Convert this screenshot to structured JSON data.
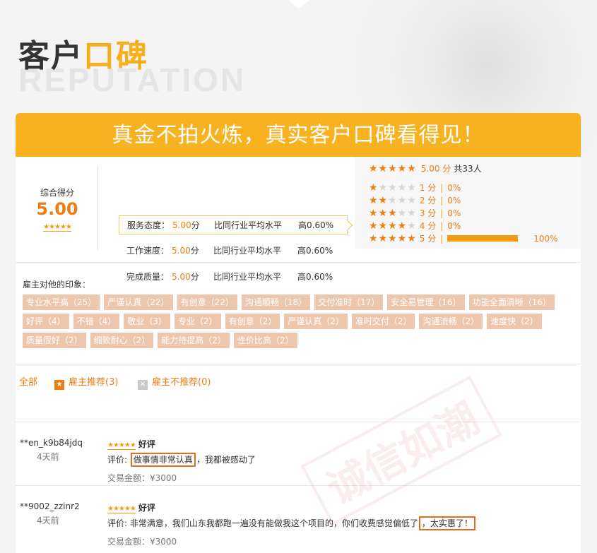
{
  "header": {
    "title_part1": "客户",
    "title_part2": "口碑",
    "watermark": "REPUTATION"
  },
  "banner": {
    "text": "真金不拍火炼，真实客户口碑看得见！"
  },
  "overall": {
    "label": "综合得分",
    "value": "5.00",
    "stars": "★★★★★"
  },
  "metrics": [
    {
      "name": "服务态度：",
      "score": "5.00",
      "unit": "分",
      "compare": "比同行业平均水平",
      "high": "高0.60%"
    },
    {
      "name": "工作速度：",
      "score": "5.00",
      "unit": "分",
      "compare": "比同行业平均水平",
      "high": "高0.60%"
    },
    {
      "name": "完成质量：",
      "score": "5.00",
      "unit": "分",
      "compare": "比同行业平均水平",
      "high": "高0.60%"
    }
  ],
  "distribution": {
    "stars": "★★★★★",
    "avg": "5.00 分",
    "count": "共33人",
    "rows": [
      {
        "on": "★",
        "off": "★★★★",
        "level": "1 分",
        "percent": "0%",
        "fill": 0
      },
      {
        "on": "★★",
        "off": "★★★",
        "level": "2 分",
        "percent": "0%",
        "fill": 0
      },
      {
        "on": "★★★",
        "off": "★★",
        "level": "3 分",
        "percent": "0%",
        "fill": 0
      },
      {
        "on": "★★★★",
        "off": "★",
        "level": "4 分",
        "percent": "0%",
        "fill": 0
      },
      {
        "on": "★★★★★",
        "off": "",
        "level": "5 分",
        "percent": "100%",
        "fill": 100
      }
    ],
    "sep": "|"
  },
  "impressions": {
    "title": "雇主对他的印象：",
    "lines": [
      [
        "专业水平高（25）",
        "严谨认真（22）",
        "有创意（22）",
        "沟通顺畅（18）",
        "交付准时（17）",
        "安全易管理（16）",
        "功能全面清晰（16）"
      ],
      [
        "好评（4）",
        "不错（4）",
        "敬业（3）",
        "专业（2）",
        "有创意（2）",
        "严谨认真（2）",
        "准时交付（2）",
        "沟通流畅（2）",
        "速度快（2）"
      ],
      [
        "质量很好（2）",
        "细致耐心（2）",
        "能力待提高（2）",
        "性价比高（2）"
      ]
    ]
  },
  "filters": {
    "all": "全部",
    "recommend": "雇主推荐(3)",
    "not_recommend": "雇主不推荐(0)",
    "recommend_icon": "★",
    "not_recommend_icon": "✕"
  },
  "reviews": [
    {
      "user": "**en_k9b84jdq",
      "time": "4天前",
      "stars": "★★★★★",
      "rating": "好评",
      "prefix": "评价: ",
      "highlight": "做事情非常认真",
      "suffix": "，我都被感动了",
      "amount": "交易金额：¥3000"
    },
    {
      "user": "**9002_zzinr2",
      "time": "4天前",
      "stars": "★★★★★",
      "rating": "好评",
      "prefix": "评价: 非常满意，我们山东我都跑一遍没有能做我这个项目的，你们收费感觉偏低了",
      "highlight": "，太实惠了！",
      "suffix": "",
      "amount": "交易金额：¥3000"
    }
  ],
  "stamp_watermark": "诚信如潮",
  "colors": {
    "accent": "#f8b21f",
    "orange": "#ef7d12",
    "tag_bg": "#edc6ae"
  }
}
